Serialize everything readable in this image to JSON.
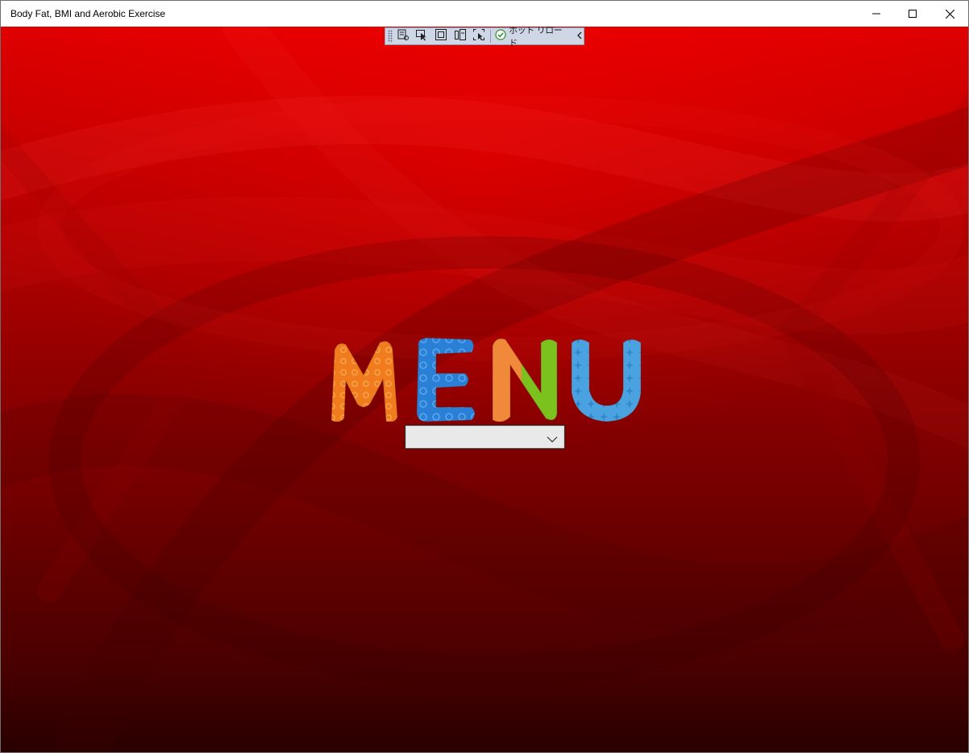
{
  "window": {
    "title": "Body Fat, BMI and Aerobic Exercise",
    "controls": [
      "minimize-icon",
      "maximize-icon",
      "close-icon"
    ]
  },
  "debug_toolbar": {
    "tools": [
      "live-visual-tree-icon",
      "select-element-icon",
      "display-layout-adorners-icon",
      "track-focus-icon",
      "binding-failures-icon"
    ],
    "hot_reload_label": "ホット リロード",
    "hot_reload_status_icon": "check-circle-icon",
    "collapse_icon": "chevron-left-icon"
  },
  "main": {
    "logo_text": "MENU",
    "logo_letter_colors": [
      "#f07c1e",
      "#2a7fd6",
      "#f08a3a",
      "#4aa3e0"
    ],
    "combo": {
      "selected_value": "",
      "arrow_icon": "chevron-down-icon"
    }
  },
  "colors": {
    "background_top": "#e00000",
    "background_bottom": "#3e0000",
    "toolbar_bg": "#cfd6e5"
  }
}
